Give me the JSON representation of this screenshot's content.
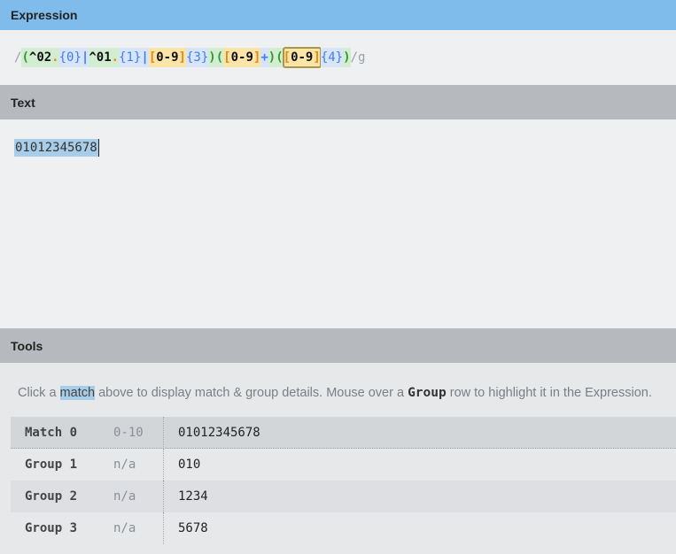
{
  "panels": {
    "expression": "Expression",
    "text": "Text",
    "tools": "Tools"
  },
  "expression": {
    "open_delim": "/",
    "flags": "/g",
    "tokens": [
      {
        "t": "(",
        "c": "grp"
      },
      {
        "t": "^",
        "c": "anchor"
      },
      {
        "t": "02",
        "c": "anchor"
      },
      {
        "t": ".",
        "c": "dot"
      },
      {
        "t": "{0}",
        "c": "quant"
      },
      {
        "t": "|",
        "c": "alt"
      },
      {
        "t": "^",
        "c": "anchor"
      },
      {
        "t": "01",
        "c": "anchor"
      },
      {
        "t": ".",
        "c": "dot"
      },
      {
        "t": "{1}",
        "c": "quant"
      },
      {
        "t": "|",
        "c": "alt"
      },
      {
        "t": "[",
        "c": "set"
      },
      {
        "t": "0-9",
        "c": "setin"
      },
      {
        "t": "]",
        "c": "set"
      },
      {
        "t": "{3}",
        "c": "quant"
      },
      {
        "t": ")",
        "c": "grp"
      },
      {
        "t": "(",
        "c": "grp"
      },
      {
        "t": "[",
        "c": "set"
      },
      {
        "t": "0-9",
        "c": "setin"
      },
      {
        "t": "]",
        "c": "set"
      },
      {
        "t": "+",
        "c": "plus"
      },
      {
        "t": ")",
        "c": "grp"
      },
      {
        "t": "(",
        "c": "grp"
      },
      {
        "t": "[0-9]",
        "c": "hl"
      },
      {
        "t": "{4}",
        "c": "quant"
      },
      {
        "t": ")",
        "c": "grp"
      }
    ]
  },
  "text": {
    "value": "01012345678"
  },
  "tools": {
    "message_pre": "Click a ",
    "message_kw1": "match",
    "message_mid": " above to display match & group details. Mouse over a ",
    "message_kw2": "Group",
    "message_post": " row to highlight it in the Expression.",
    "rows": [
      {
        "name": "Match 0",
        "range": "0-10",
        "value": "01012345678"
      },
      {
        "name": "Group 1",
        "range": "n/a",
        "value": "010"
      },
      {
        "name": "Group 2",
        "range": "n/a",
        "value": "1234"
      },
      {
        "name": "Group 3",
        "range": "n/a",
        "value": "5678"
      }
    ]
  }
}
